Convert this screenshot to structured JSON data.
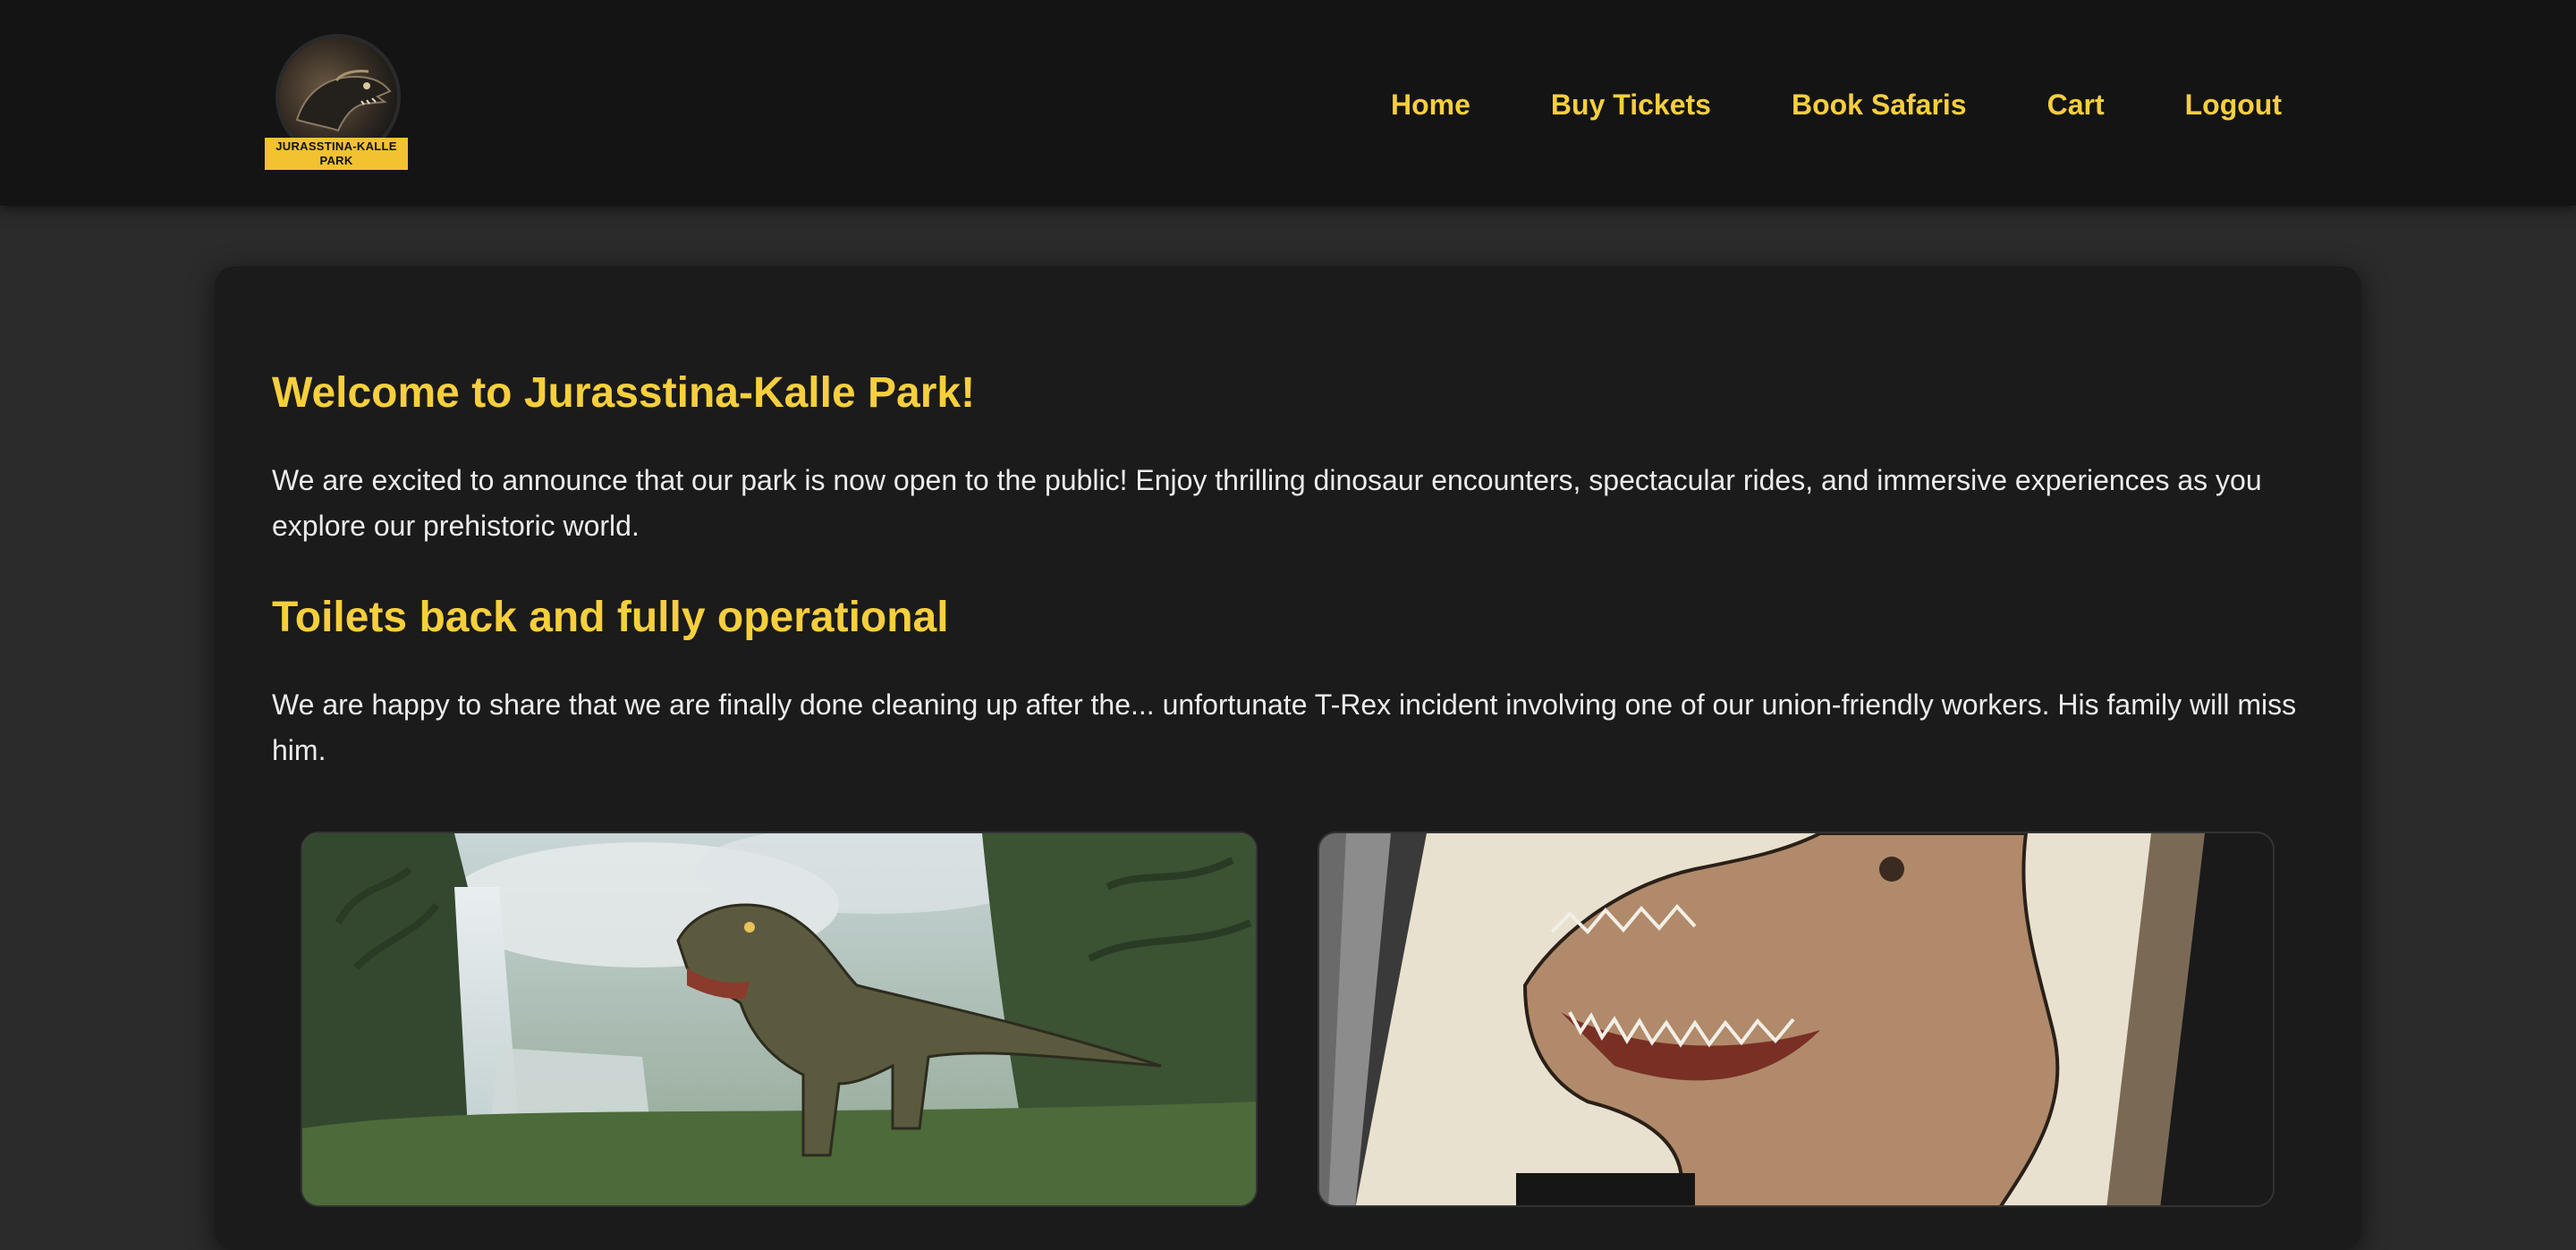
{
  "header": {
    "logo": {
      "label": "JURASSTINA-KALLE PARK",
      "icon": "dinosaur-head-logo"
    },
    "nav": [
      {
        "label": "Home"
      },
      {
        "label": "Buy Tickets"
      },
      {
        "label": "Book Safaris"
      },
      {
        "label": "Cart"
      },
      {
        "label": "Logout"
      }
    ]
  },
  "main": {
    "sections": [
      {
        "heading": "Welcome to Jurasstina-Kalle Park!",
        "text": "We are excited to announce that our park is now open to the public! Enjoy thrilling dinosaur encounters, spectacular rides, and immersive experiences as you explore our prehistoric world."
      },
      {
        "heading": "Toilets back and fully operational",
        "text": "We are happy to share that we are finally done cleaning up after the... unfortunate T-Rex incident involving one of our union-friendly workers. His family will miss him."
      }
    ],
    "gallery": [
      {
        "image": "t-rex-in-jungle-with-waterfall"
      },
      {
        "image": "t-rex-illustrated-poster"
      }
    ]
  },
  "colors": {
    "accent": "#f6cf3c",
    "header_bg": "#141414",
    "page_bg": "#2b2b2b",
    "card_bg": "#1b1b1b",
    "text": "#ececec",
    "logo_label_bg": "#f2c230"
  }
}
